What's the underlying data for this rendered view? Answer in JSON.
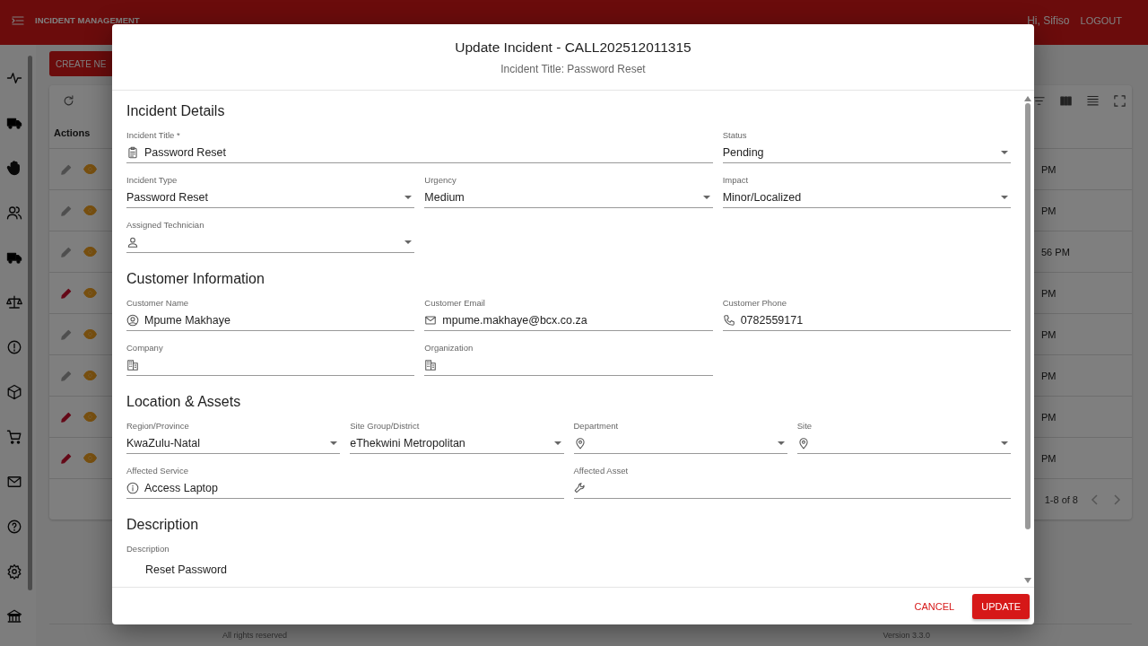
{
  "app_bar": {
    "title": "INCIDENT MANAGEMENT",
    "greeting": "Hi, Sifiso",
    "logout": "LOGOUT"
  },
  "create_button": "CREATE NE",
  "table": {
    "actions_header": "Actions",
    "rows": [
      {
        "editable": false,
        "time": "PM"
      },
      {
        "editable": false,
        "time": "PM"
      },
      {
        "editable": false,
        "time": "56 PM"
      },
      {
        "editable": true,
        "time": "PM"
      },
      {
        "editable": false,
        "time": "PM"
      },
      {
        "editable": false,
        "time": "PM"
      },
      {
        "editable": true,
        "time": "PM"
      },
      {
        "editable": true,
        "time": "PM"
      }
    ],
    "pagination": "1-8 of 8"
  },
  "footer": {
    "left": "All rights reserved",
    "right": "Version 3.3.0"
  },
  "dialog": {
    "title": "Update Incident - CALL202512011315",
    "subtitle": "Incident Title: Password Reset",
    "sections": [
      {
        "title": "Incident Details",
        "fields": [
          {
            "label": "Incident Title *",
            "value": "Password Reset",
            "kind": "text"
          },
          {
            "label": "Status",
            "value": "Pending",
            "kind": "select"
          },
          {
            "label": "Incident Type",
            "value": "Password Reset",
            "kind": "select"
          },
          {
            "label": "Urgency",
            "value": "Medium",
            "kind": "select"
          },
          {
            "label": "Impact",
            "value": "Minor/Localized",
            "kind": "select"
          },
          {
            "label": "Assigned Technician",
            "kind": "select"
          }
        ]
      },
      {
        "title": "Customer Information",
        "fields": [
          {
            "label": "Customer Name",
            "value": "Mpume Makhaye",
            "kind": "text"
          },
          {
            "label": "Customer Email",
            "value": "mpume.makhaye@bcx.co.za",
            "kind": "text"
          },
          {
            "label": "Customer Phone",
            "value": "0782559171",
            "kind": "text"
          },
          {
            "label": "Company",
            "kind": "text"
          },
          {
            "label": "Organization",
            "kind": "text"
          }
        ]
      },
      {
        "title": "Location & Assets",
        "fields": [
          {
            "label": "Region/Province",
            "value": "KwaZulu-Natal",
            "kind": "select"
          },
          {
            "label": "Site Group/District",
            "value": "eThekwini Metropolitan",
            "kind": "select"
          },
          {
            "label": "Department",
            "kind": "select"
          },
          {
            "label": "Site",
            "kind": "select"
          },
          {
            "label": "Affected Service",
            "value": "Access Laptop",
            "kind": "text"
          },
          {
            "label": "Affected Asset",
            "kind": "text"
          }
        ]
      },
      {
        "title": "Description",
        "fields": [
          {
            "label": "Description",
            "value": "Reset Password",
            "kind": "textarea"
          }
        ]
      }
    ],
    "cancel": "CANCEL",
    "update": "UPDATE"
  }
}
